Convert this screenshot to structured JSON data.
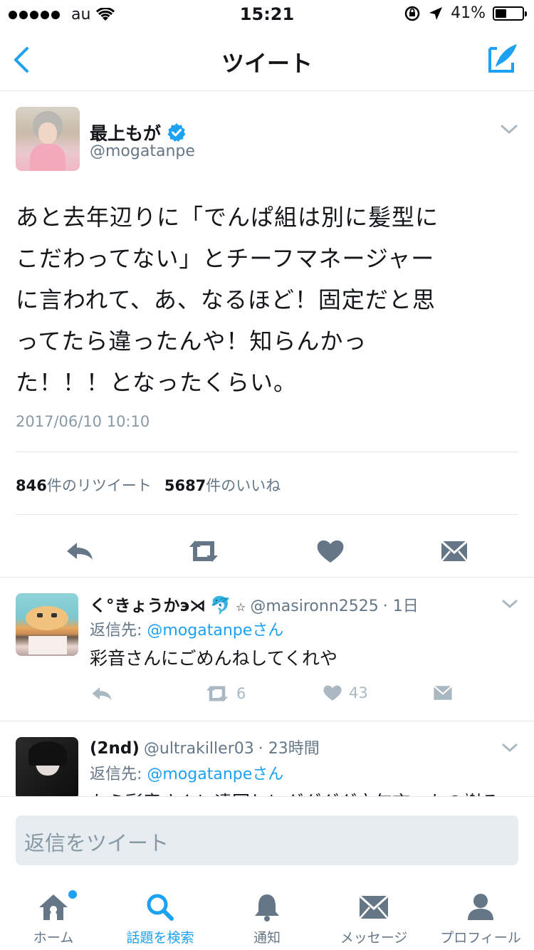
{
  "status_bar": {
    "carrier": "au",
    "time": "15:21",
    "battery_percent_text": "41%",
    "battery_level": 0.41
  },
  "nav": {
    "title": "ツイート",
    "icons": {
      "back": "chevron-left-icon",
      "compose": "compose-icon"
    }
  },
  "tweet": {
    "user_name": "最上もが",
    "user_handle": "@mogatanpe",
    "verified": true,
    "text_lines": [
      "あと去年辺りに「でんぱ組は別に髪型に",
      "こだわってない」とチーフマネージャー",
      "に言われて、あ、なるほど！固定だと思",
      "ってたら違ったんや！知らんかっ",
      "た！！！となったくらい。"
    ],
    "timestamp": "2017/06/10 10:10",
    "retweet_count": "846",
    "retweet_label": "件のリツイート",
    "like_count": "5687",
    "like_label": "件のいいね"
  },
  "replies": [
    {
      "name": "く°きょうかэ⋊",
      "emoji": "🐬",
      "star": "☆",
      "handle": "@masironn2525",
      "time": "· 1日",
      "reply_prefix": "返信先: ",
      "reply_mention": "@mogatanpe",
      "reply_suffix": "さん",
      "text": "彩音さんにごめんねしてくれや",
      "retweets": "6",
      "likes": "43"
    },
    {
      "name": "(2nd)",
      "handle": "@ultrakiller03",
      "time": "· 23時間",
      "reply_prefix": "返信先: ",
      "reply_mention": "@mogatanpe",
      "reply_suffix": "さん",
      "text": "なら彩音さんに遠回しにグダグダ文句言ったの謝る"
    }
  ],
  "composer": {
    "placeholder": "返信をツイート"
  },
  "tabs": [
    {
      "label": "ホーム",
      "icon": "home-icon",
      "active": false
    },
    {
      "label": "話題を検索",
      "icon": "search-icon",
      "active": true
    },
    {
      "label": "通知",
      "icon": "bell-icon",
      "active": false
    },
    {
      "label": "メッセージ",
      "icon": "mail-icon",
      "active": false
    },
    {
      "label": "プロフィール",
      "icon": "person-icon",
      "active": false
    }
  ],
  "colors": {
    "accent": "#1da1f2",
    "icon_gray": "#657786",
    "light_gray": "#aab8c2"
  }
}
